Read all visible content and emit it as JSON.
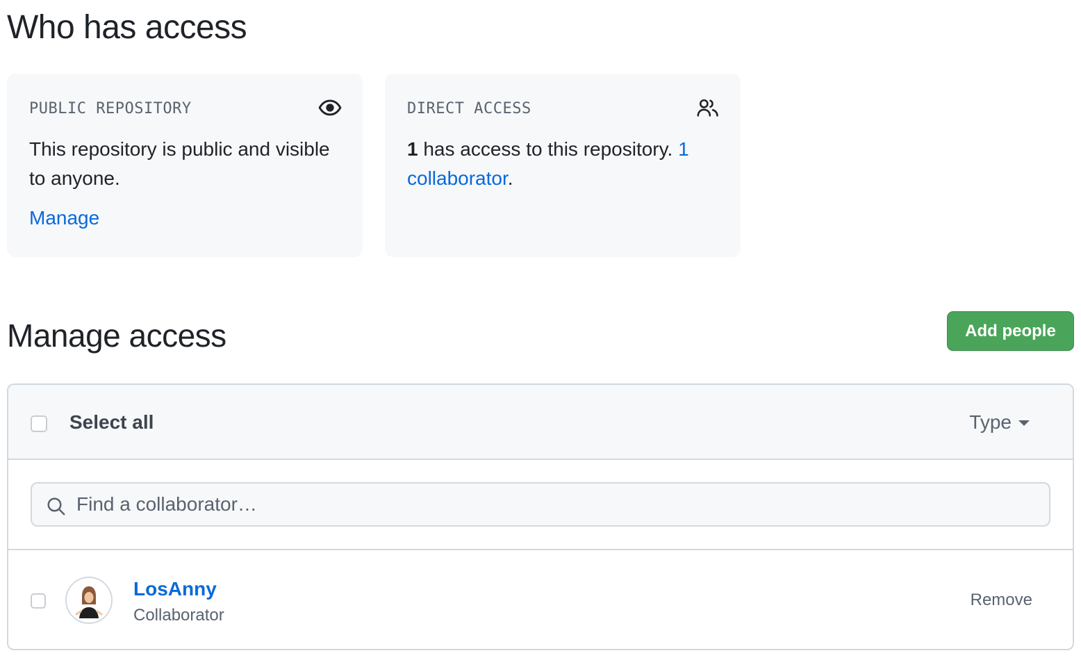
{
  "who_has_access": {
    "title": "Who has access",
    "public_card": {
      "label": "PUBLIC REPOSITORY",
      "icon": "eye-icon",
      "text": "This repository is public and visible to anyone.",
      "link": "Manage"
    },
    "direct_card": {
      "label": "DIRECT ACCESS",
      "icon": "people-icon",
      "count": "1",
      "text": " has access to this repository. ",
      "link": "1 collaborator",
      "suffix": "."
    }
  },
  "manage_access": {
    "title": "Manage access",
    "add_button": "Add people",
    "select_all": "Select all",
    "type_filter": "Type",
    "search_placeholder": "Find a collaborator…",
    "collaborators": [
      {
        "username": "LosAnny",
        "role": "Collaborator",
        "action": "Remove"
      }
    ]
  },
  "colors": {
    "link": "#0969da",
    "primary_button": "#4aa55a",
    "card_bg": "#f6f8fa",
    "border": "#d1d9e0"
  }
}
